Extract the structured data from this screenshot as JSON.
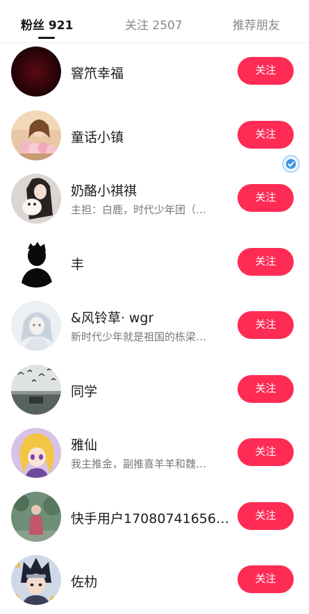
{
  "tabs": {
    "fans": "粉丝 921",
    "following": "关注 2507",
    "recommend": "推荐朋友"
  },
  "accent_color": "#fe2c55",
  "users": [
    {
      "name": "窨笊幸福",
      "desc": "",
      "button": "关注",
      "avatar_icon": "dark-red-avatar"
    },
    {
      "name": "童话小镇",
      "desc": "",
      "button": "关注",
      "avatar_icon": "girl-with-flowers-avatar"
    },
    {
      "name": "奶酪小祺祺",
      "desc": "主担：白鹿，时代少年团（…",
      "button": "关注",
      "avatar_icon": "girl-with-dog-avatar"
    },
    {
      "name": "丰",
      "desc": "",
      "button": "关注",
      "avatar_icon": "black-silhouette-avatar"
    },
    {
      "name": "&风铃草· wgr",
      "desc": "新时代少年就是祖国的栋梁…",
      "button": "关注",
      "avatar_icon": "anime-girl-sketch-avatar"
    },
    {
      "name": "同学",
      "desc": "",
      "button": "关注",
      "avatar_icon": "lake-birds-avatar"
    },
    {
      "name": "雅仙",
      "desc": "我主推金，副推喜羊羊和魏…",
      "button": "关注",
      "avatar_icon": "anime-girl-purple-avatar"
    },
    {
      "name": "快手用户17080741656…",
      "desc": "",
      "button": "关注",
      "avatar_icon": "person-in-garden-avatar"
    },
    {
      "name": "佐朸",
      "desc": "",
      "button": "关注",
      "avatar_icon": "anime-ninja-avatar"
    }
  ]
}
